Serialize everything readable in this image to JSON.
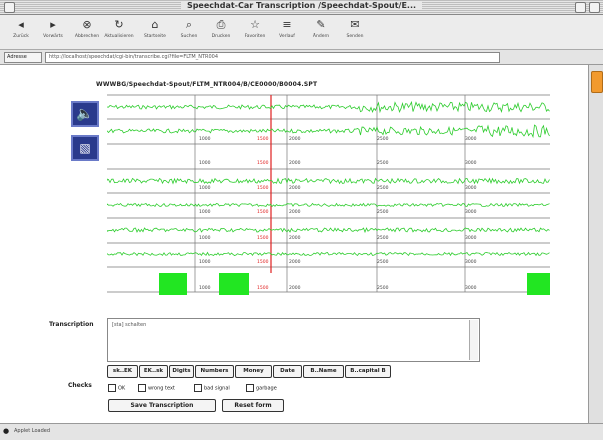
{
  "window": {
    "title": "Speechdat-Car Transcription /Speechdat-Spout/E..."
  },
  "toolbar": {
    "items": [
      {
        "icon": "back-icon",
        "glyph": "◂",
        "label": "Zurück"
      },
      {
        "icon": "forward-icon",
        "glyph": "▸",
        "label": "Vorwärts"
      },
      {
        "icon": "stop-icon",
        "glyph": "⊗",
        "label": "Abbrechen"
      },
      {
        "icon": "refresh-icon",
        "glyph": "↻",
        "label": "Aktualisieren"
      },
      {
        "icon": "home-icon",
        "glyph": "⌂",
        "label": "Startseite"
      },
      {
        "icon": "search-icon",
        "glyph": "⌕",
        "label": "Suchen"
      },
      {
        "icon": "print-icon",
        "glyph": "⎙",
        "label": "Drucken"
      },
      {
        "icon": "favorites-icon",
        "glyph": "☆",
        "label": "Favoriten"
      },
      {
        "icon": "history-icon",
        "glyph": "≡",
        "label": "Verlauf"
      },
      {
        "icon": "edit-icon",
        "glyph": "✎",
        "label": "Ändern"
      },
      {
        "icon": "mail-icon",
        "glyph": "✉",
        "label": "Senden"
      }
    ]
  },
  "address": {
    "label": "Adresse",
    "url": "http://localhost/speechdat/cgi-bin/transcribe.cgi?file=FLTM_NTR004"
  },
  "page": {
    "file_path": "WWWBG/Speechdat-Spout/FLTM_NTR004/B/CE0000/B0004.SPT",
    "transcription_label": "Transcription",
    "transcription_text": "[sta] schalten",
    "checks_label": "Checks"
  },
  "tracks": {
    "ticks": [
      "1000",
      "1500",
      "2000",
      "2500",
      "3000"
    ],
    "tick_color": "#444444",
    "marker_color": "#e02020",
    "wave_color": "#2dcc2d",
    "block_color": "#22e622"
  },
  "tags": [
    {
      "label": "sk..EK"
    },
    {
      "label": "EK..sk"
    },
    {
      "label": "Digits"
    },
    {
      "label": "Numbers"
    },
    {
      "label": "Money"
    },
    {
      "label": "Date"
    },
    {
      "label": "B..Name"
    },
    {
      "label": "B..capital B"
    }
  ],
  "checks": [
    {
      "label": "OK"
    },
    {
      "label": "wrong text"
    },
    {
      "label": "bad signal"
    },
    {
      "label": "garbage"
    }
  ],
  "actions": {
    "save_label": "Save Transcription",
    "reset_label": "Reset form"
  },
  "status": {
    "text": "Applet Loaded"
  }
}
